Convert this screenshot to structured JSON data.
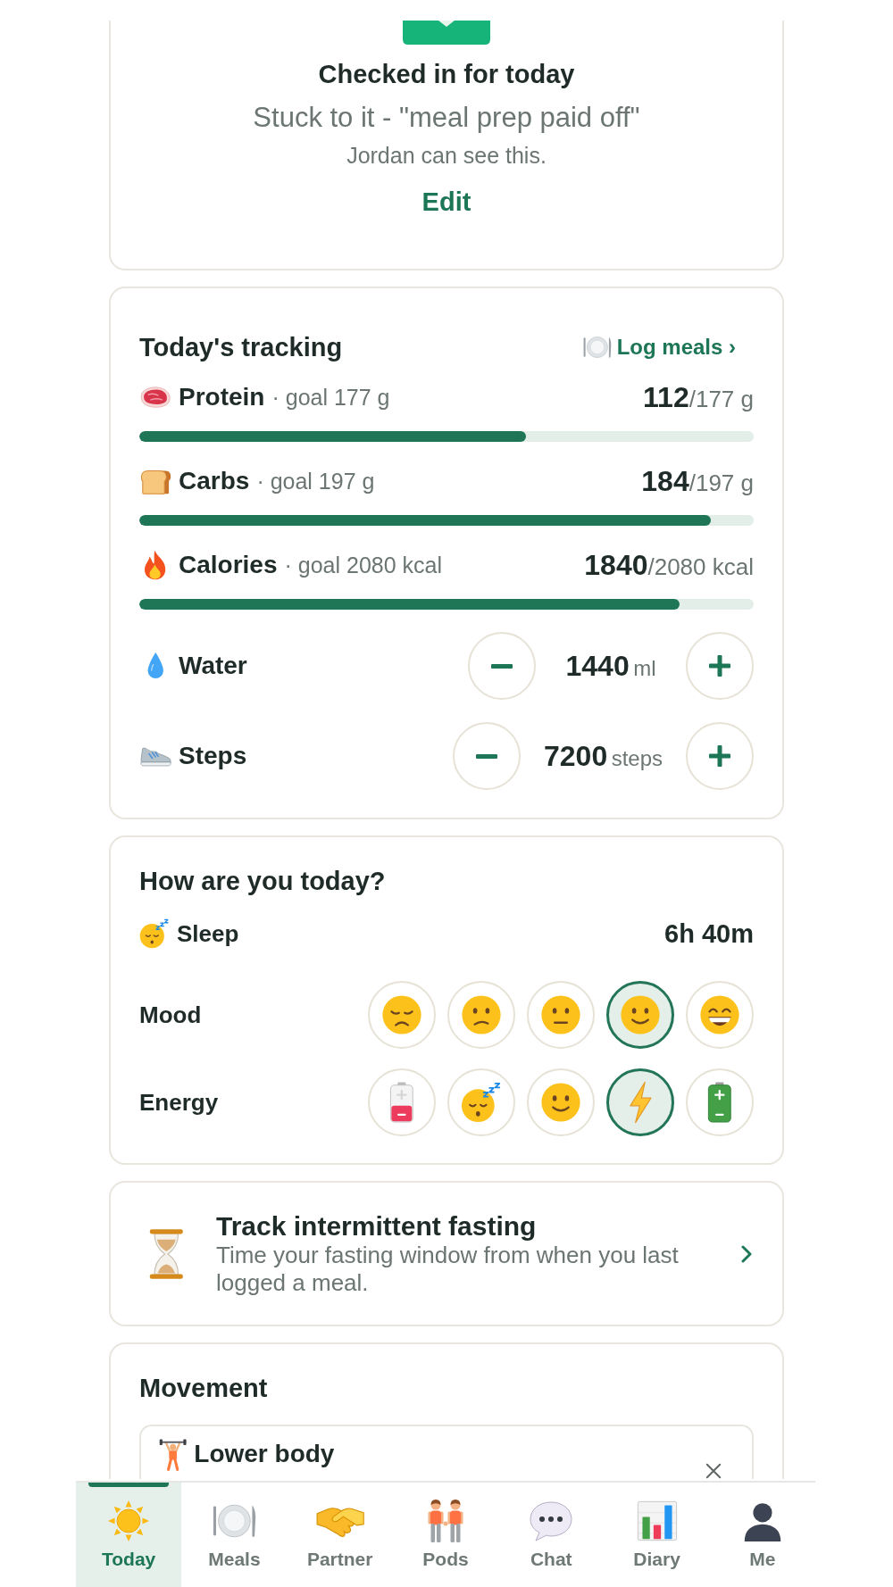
{
  "checkin": {
    "title": "Checked in for today",
    "note": "Stuck to it - \"meal prep paid off\"",
    "visibility": "Jordan can see this.",
    "edit": "Edit"
  },
  "tracking": {
    "title": "Today's tracking",
    "link": "Log meals ›",
    "nutrients": [
      {
        "kind": "meat",
        "name": "Protein",
        "goal": "· goal 177 g",
        "amount": "112",
        "total": "/177 g",
        "level": 0.63
      },
      {
        "kind": "bread",
        "name": "Carbs",
        "goal": "· goal 197 g",
        "amount": "184",
        "total": "/197 g",
        "level": 0.93
      },
      {
        "kind": "fire",
        "name": "Calories",
        "goal": "· goal 2080 kcal",
        "amount": "1840",
        "total": "/2080 kcal",
        "level": 0.88
      }
    ],
    "counters": [
      {
        "kind": "drop",
        "name": "Water",
        "amount": "1440",
        "unit": "ml"
      },
      {
        "kind": "shoe",
        "name": "Steps",
        "amount": "7200",
        "unit": "steps"
      }
    ]
  },
  "wellbeing": {
    "title": "How are you today?",
    "sleep": {
      "label": "Sleep",
      "value": "6h 40m"
    },
    "scales": [
      {
        "label": "Mood",
        "options": [
          {
            "kind": "sad",
            "selected": false
          },
          {
            "kind": "worried",
            "selected": false
          },
          {
            "kind": "neutral",
            "selected": false
          },
          {
            "kind": "smile",
            "selected": true
          },
          {
            "kind": "grin",
            "selected": false
          }
        ]
      },
      {
        "label": "Energy",
        "options": [
          {
            "kind": "lowbattery",
            "selected": false
          },
          {
            "kind": "sleepy",
            "selected": false
          },
          {
            "kind": "smile",
            "selected": false
          },
          {
            "kind": "bolt",
            "selected": true
          },
          {
            "kind": "battery",
            "selected": false
          }
        ]
      }
    ]
  },
  "fasting": {
    "title": "Track intermittent fasting",
    "description": "Time your fasting window from when you last logged a meal."
  },
  "movement": {
    "title": "Movement",
    "items": [
      {
        "kind": "lifter",
        "name": "Lower body"
      }
    ]
  },
  "nav": {
    "items": [
      {
        "kind": "sun",
        "label": "Today",
        "selected": true
      },
      {
        "kind": "plate",
        "label": "Meals",
        "selected": false
      },
      {
        "kind": "handshake",
        "label": "Partner",
        "selected": false
      },
      {
        "kind": "couple",
        "label": "Pods",
        "selected": false
      },
      {
        "kind": "chat",
        "label": "Chat",
        "selected": false
      },
      {
        "kind": "chart",
        "label": "Diary",
        "selected": false
      },
      {
        "kind": "person",
        "label": "Me",
        "selected": false
      }
    ]
  }
}
